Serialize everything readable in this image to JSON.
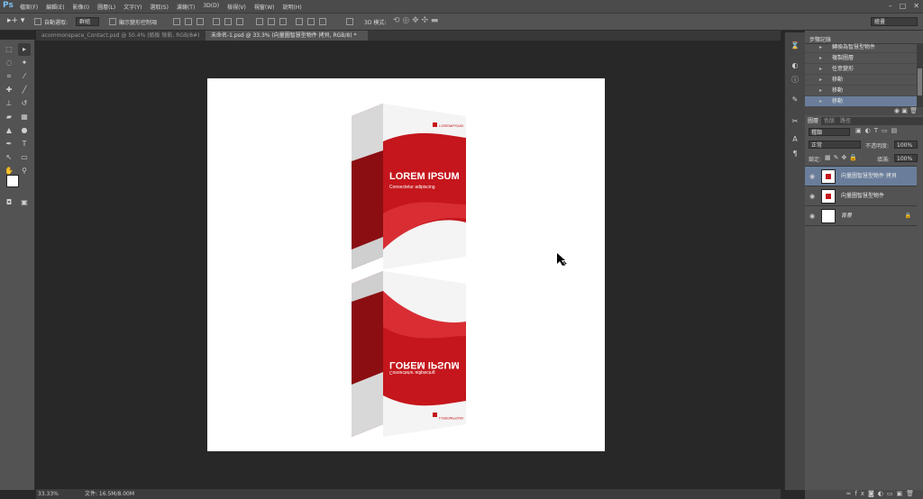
{
  "app": {
    "logo": "Ps"
  },
  "menu": [
    "檔案(F)",
    "編輯(E)",
    "影像(I)",
    "圖層(L)",
    "文字(Y)",
    "選取(S)",
    "濾鏡(T)",
    "3D(D)",
    "檢視(V)",
    "視窗(W)",
    "說明(H)"
  ],
  "options": {
    "auto_select_label": "自動選取:",
    "auto_select_value": "群組",
    "show_transform_label": "顯示變形控制項",
    "mode3d_label": "3D 模式:",
    "workspace_value": "繪畫"
  },
  "tabs": [
    {
      "label": "acommonspace_Contact.psd @ 50.4% (紙板 陰影, RGB/8#)",
      "active": false
    },
    {
      "label": "未命名-1.psd @ 33.3% (向量圖智慧型物件 拷貝, RGB/8) *",
      "active": true
    }
  ],
  "status": {
    "zoom": "33.33%",
    "doc": "文件: 16.5M/8.00M"
  },
  "history": {
    "title": "步驟記錄",
    "items": [
      "轉換為智慧型物件",
      "複製圖層",
      "任意變形",
      "移動",
      "移動",
      "移動"
    ],
    "selected_index": 5
  },
  "layers_panel": {
    "tabs": [
      "圖層",
      "色版",
      "路徑"
    ],
    "filter_value": "種類",
    "blend_mode": "正常",
    "opacity_label": "不透明度:",
    "opacity_value": "100%",
    "lock_label": "鎖定:",
    "fill_label": "填滿:",
    "fill_value": "100%",
    "layers": [
      {
        "name": "向量圖智慧型物件 拷貝",
        "selected": true
      },
      {
        "name": "向量圖智慧型物件",
        "selected": false
      },
      {
        "name": "背景",
        "selected": false
      }
    ]
  },
  "artwork": {
    "title": "LOREM IPSUM",
    "subtitle": "Consectetur adipiscing",
    "brand": "LOREMIPSUM",
    "colors": {
      "red": "#c4161c",
      "dark_red": "#8b0e12",
      "grey": "#d9d9d9"
    }
  }
}
